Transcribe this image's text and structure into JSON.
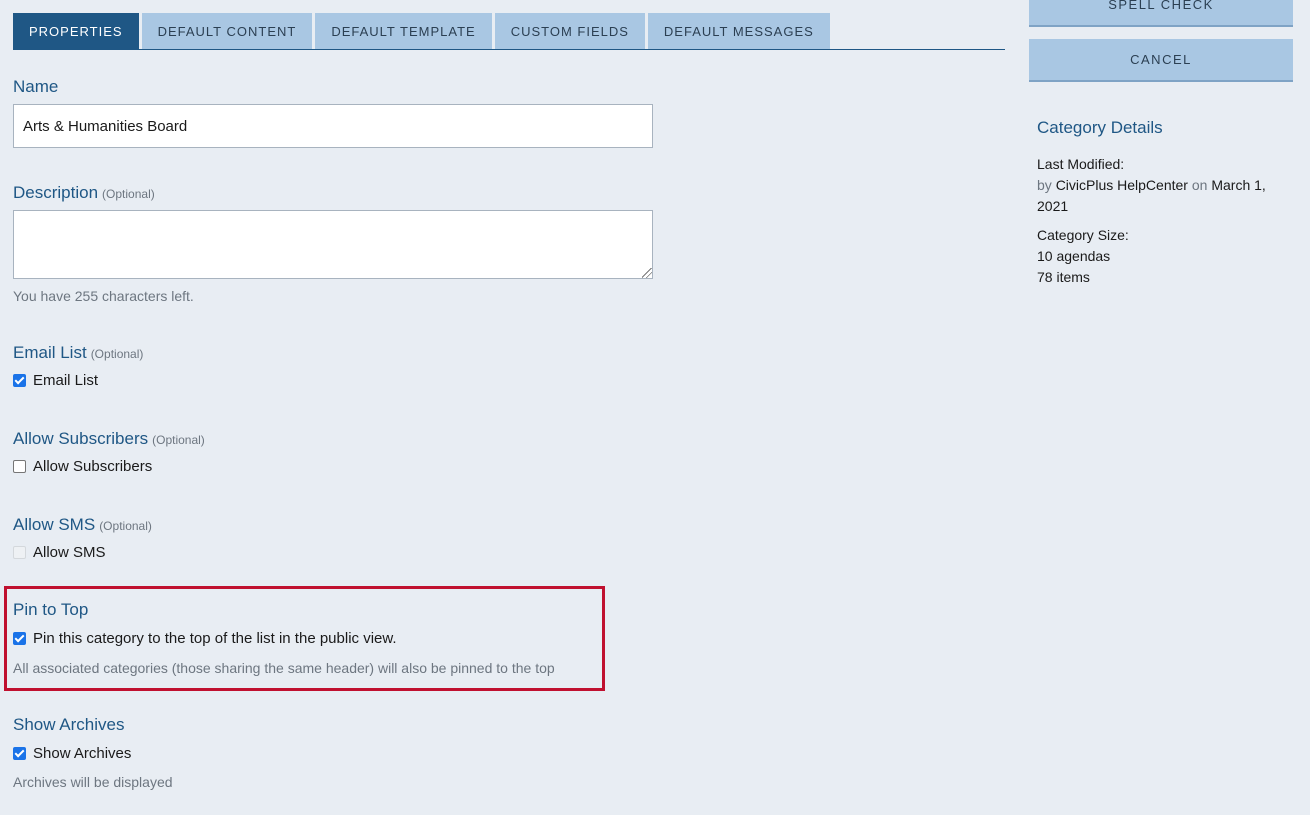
{
  "tabs": [
    {
      "label": "PROPERTIES",
      "active": true
    },
    {
      "label": "DEFAULT CONTENT",
      "active": false
    },
    {
      "label": "DEFAULT TEMPLATE",
      "active": false
    },
    {
      "label": "CUSTOM FIELDS",
      "active": false
    },
    {
      "label": "DEFAULT MESSAGES",
      "active": false
    }
  ],
  "form": {
    "name": {
      "label": "Name",
      "value": "Arts & Humanities Board"
    },
    "description": {
      "label": "Description",
      "optional": "(Optional)",
      "value": "",
      "help": "You have 255 characters left."
    },
    "email_list": {
      "label": "Email List",
      "optional": "(Optional)",
      "checkbox_label": "Email List",
      "checked": true
    },
    "allow_subscribers": {
      "label": "Allow Subscribers",
      "optional": "(Optional)",
      "checkbox_label": "Allow Subscribers",
      "checked": false
    },
    "allow_sms": {
      "label": "Allow SMS",
      "optional": "(Optional)",
      "checkbox_label": "Allow SMS",
      "checked": false,
      "disabled": true
    },
    "pin_to_top": {
      "label": "Pin to Top",
      "checkbox_label": "Pin this category to the top of the list in the public view.",
      "checked": true,
      "help": "All associated categories (those sharing the same header) will also be pinned to the top"
    },
    "show_archives": {
      "label": "Show Archives",
      "checkbox_label": "Show Archives",
      "checked": true,
      "help": "Archives will be displayed"
    }
  },
  "sidebar": {
    "spell_check_label": "SPELL CHECK",
    "cancel_label": "CANCEL",
    "details_title": "Category Details",
    "last_modified_label": "Last Modified:",
    "by_word": "by",
    "modified_by": "CivicPlus HelpCenter",
    "on_word": "on",
    "modified_date": "March 1, 2021",
    "size_label": "Category Size:",
    "agendas": "10 agendas",
    "items": "78 items"
  },
  "colors": {
    "accent": "#1f5785",
    "tab_inactive": "#a9c7e3",
    "highlight": "#c0102f",
    "background": "#e8edf3"
  }
}
